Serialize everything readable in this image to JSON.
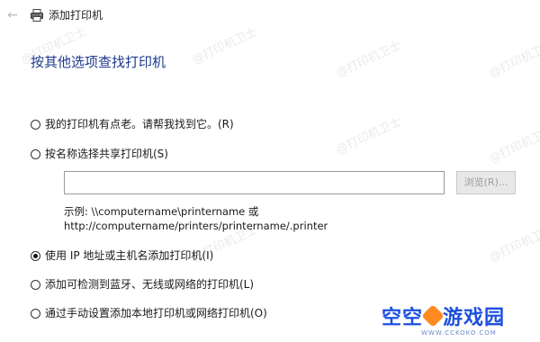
{
  "window": {
    "title": "添加打印机",
    "back_icon": "back-arrow-icon",
    "printer_icon": "printer-icon"
  },
  "page": {
    "heading": "按其他选项查找打印机"
  },
  "options": [
    {
      "label": "我的打印机有点老。请帮我找到它。(R)",
      "selected": false
    },
    {
      "label": "按名称选择共享打印机(S)",
      "selected": false
    },
    {
      "label": "使用 IP 地址或主机名添加打印机(I)",
      "selected": true
    },
    {
      "label": "添加可检测到蓝牙、无线或网络的打印机(L)",
      "selected": false
    },
    {
      "label": "通过手动设置添加本地打印机或网络打印机(O)",
      "selected": false
    }
  ],
  "shared_printer": {
    "input_value": "",
    "browse_label": "浏览(R)...",
    "example_line1": "示例: \\\\computername\\printername 或",
    "example_line2": "http://computername/printers/printername/.printer"
  },
  "watermark": {
    "text": "@打印机卫士"
  },
  "brand": {
    "part1": "空空",
    "part2": "游戏园",
    "url": "WWW.CCKOKO.COM"
  }
}
